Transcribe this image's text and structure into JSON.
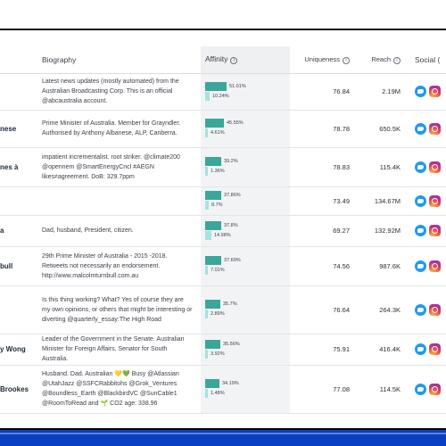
{
  "columns": {
    "biography": "Biography",
    "affinity": "Affinity",
    "uniqueness": "Uniqueness",
    "reach": "Reach",
    "social": "Social ("
  },
  "rows": [
    {
      "name": "",
      "bio": "Latest news updates (mostly automated) from the Australian Broadcasting Corp. This is an official @abcaustralia account.",
      "aff1": "51.01%",
      "aff2": "10.24%",
      "aff1_value": 51.01,
      "aff2_value": 10.24,
      "uniqueness": "76.84",
      "reach": "2.19M"
    },
    {
      "name": "nese",
      "bio": "Prime Minister of Australia. Member for Grayndler. Authorised by Anthony Albanese, ALP, Canberra.",
      "aff1": "45.55%",
      "aff2": "4.61%",
      "aff1_value": 45.55,
      "aff2_value": 4.61,
      "uniqueness": "78.78",
      "reach": "650.5K"
    },
    {
      "name": "nes à",
      "bio": "impatient incrementalist. root striker. @climate200 @opennem @SmartEnergyCncl #AEGN likes≠agreement. DoB: 329.7ppm",
      "aff1": "39.2%",
      "aff2": "1.36%",
      "aff1_value": 39.2,
      "aff2_value": 1.36,
      "uniqueness": "78.83",
      "reach": "115.4K"
    },
    {
      "name": "",
      "bio": "",
      "aff1": "37.86%",
      "aff2": "8.7%",
      "aff1_value": 37.86,
      "aff2_value": 8.7,
      "uniqueness": "73.49",
      "reach": "134.67M"
    },
    {
      "name": "a",
      "bio": "Dad, husband, President, citizen.",
      "aff1": "37.8%",
      "aff2": "14.98%",
      "aff1_value": 37.8,
      "aff2_value": 14.98,
      "uniqueness": "69.27",
      "reach": "132.92M"
    },
    {
      "name": "bull",
      "bio": "29th Prime Minister of Australia - 2015 -2018. Retweets not necessarily an endorsement. http://www.malcolmturnbull.com.au",
      "aff1": "37.69%",
      "aff2": "7.01%",
      "aff1_value": 37.69,
      "aff2_value": 7.01,
      "uniqueness": "74.56",
      "reach": "987.6K"
    },
    {
      "name": "",
      "bio": "Is this thing working? What? Yes of course they are my own opinions, or others that might be interesting or diverting @quarterly_essay:The High Road",
      "aff1": "35.7%",
      "aff2": "2.89%",
      "aff1_value": 35.7,
      "aff2_value": 2.89,
      "uniqueness": "76.64",
      "reach": "264.3K"
    },
    {
      "name": "y Wong",
      "bio": "Leader of the Government in the Senate. Australian Minister for Foreign Affairs. Senator for South Australia.",
      "aff1": "35.56%",
      "aff2": "3.92%",
      "aff1_value": 35.56,
      "aff2_value": 3.92,
      "uniqueness": "75.91",
      "reach": "416.4K"
    },
    {
      "name": "Brookes",
      "bio": "Husband. Dad. Australian 💛💚 Busy @Atlassian @UtahJazz @SSFCRabbitohs @Grok_Ventures @Boundless_Earth @BlackbirdVC @SunCable1 @RoomToRead and 🌱 CO2 age: 338.96",
      "aff1": "34.19%",
      "aff2": "1.48%",
      "aff1_value": 34.19,
      "aff2_value": 1.48,
      "uniqueness": "77.08",
      "reach": "114.5K"
    }
  ],
  "icons": {
    "info": "info-icon",
    "twitter": "twitter-icon",
    "instagram": "instagram-icon"
  },
  "colors": {
    "affinity_primary": "#3aa79a",
    "affinity_secondary": "#a9e1dc",
    "twitter": "#1d9bf0",
    "bottom_bar": "#0b3fc2"
  }
}
